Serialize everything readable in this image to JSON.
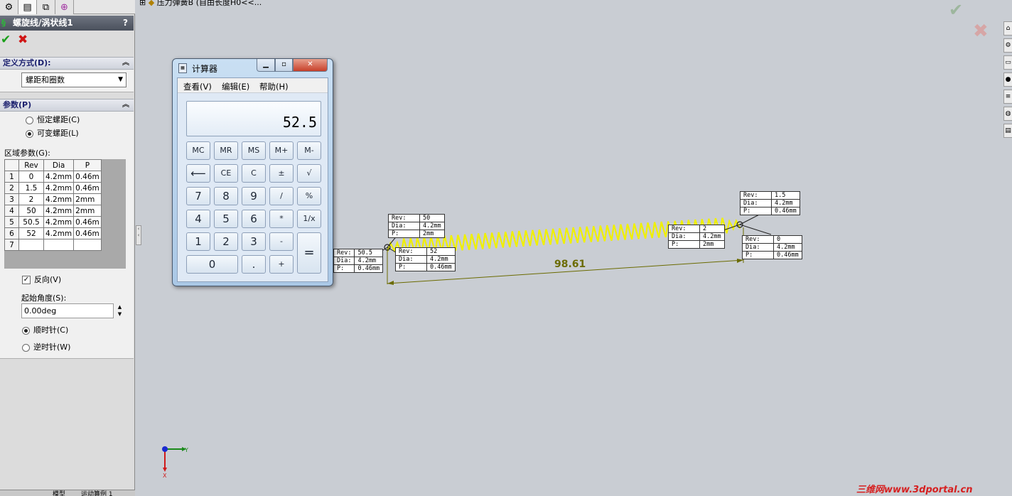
{
  "top_tabs": [
    "feature-manager-icon",
    "property-manager-icon",
    "configuration-manager-icon",
    "dimxpert-icon"
  ],
  "property_manager": {
    "title": "螺旋线/涡状线1",
    "help": "?",
    "ok": "✔",
    "cancel": "✖",
    "definition_group": {
      "heading": "定义方式(D):",
      "selected": "螺距和圈数"
    },
    "params_group": {
      "heading": "参数(P)",
      "constant_pitch": "恒定螺距(C)",
      "variable_pitch": "可变螺距(L)",
      "region_label": "区域参数(G):",
      "columns": [
        "Rev",
        "Dia",
        "P"
      ],
      "rows": [
        {
          "n": "1",
          "rev": "0",
          "dia": "4.2mm",
          "p": "0.46m"
        },
        {
          "n": "2",
          "rev": "1.5",
          "dia": "4.2mm",
          "p": "0.46m"
        },
        {
          "n": "3",
          "rev": "2",
          "dia": "4.2mm",
          "p": "2mm"
        },
        {
          "n": "4",
          "rev": "50",
          "dia": "4.2mm",
          "p": "2mm"
        },
        {
          "n": "5",
          "rev": "50.5",
          "dia": "4.2mm",
          "p": "0.46m"
        },
        {
          "n": "6",
          "rev": "52",
          "dia": "4.2mm",
          "p": "0.46m"
        },
        {
          "n": "7",
          "rev": "",
          "dia": "",
          "p": ""
        }
      ],
      "reverse": "反向(V)",
      "start_angle_label": "起始角度(S):",
      "start_angle_value": "0.00deg",
      "clockwise": "顺时针(C)",
      "counterclockwise": "逆时针(W)"
    }
  },
  "bottom_tabs": [
    "模型",
    "运动算例 1"
  ],
  "tree_crumb": "压力弹簧B  (自由长度H0<<...",
  "calculator": {
    "title": "计算器",
    "menu": [
      "查看(V)",
      "编辑(E)",
      "帮助(H)"
    ],
    "display": "52.5",
    "keys": {
      "r1": [
        "MC",
        "MR",
        "MS",
        "M+",
        "M-"
      ],
      "r2": [
        "⟵",
        "CE",
        "C",
        "±",
        "√"
      ],
      "r3": [
        "7",
        "8",
        "9",
        "/",
        "%"
      ],
      "r4": [
        "4",
        "5",
        "6",
        "*",
        "1/x"
      ],
      "r5": [
        "1",
        "2",
        "3",
        "-",
        "="
      ],
      "r6": [
        "0",
        ".",
        "+"
      ]
    }
  },
  "callouts": {
    "labels": [
      "Rev:",
      "Dia:",
      "P:"
    ],
    "c50": [
      "50",
      "4.2mm",
      "2mm"
    ],
    "c52": [
      "52",
      "4.2mm",
      "0.46mm"
    ],
    "c505": [
      "50.5",
      "4.2mm",
      "0.46mm"
    ],
    "c2": [
      "2",
      "4.2mm",
      "2mm"
    ],
    "c15": [
      "1.5",
      "4.2mm",
      "0.46mm"
    ],
    "c0": [
      "0",
      "4.2mm",
      "0.46mm"
    ]
  },
  "dimension": "98.61",
  "triad": {
    "x": "X",
    "y": "Y"
  },
  "watermark": "三维网www.3dportal.cn",
  "colors": {
    "spring": "#f0f000",
    "dimension": "#6b6b00",
    "title_bar": "#4a505c"
  }
}
